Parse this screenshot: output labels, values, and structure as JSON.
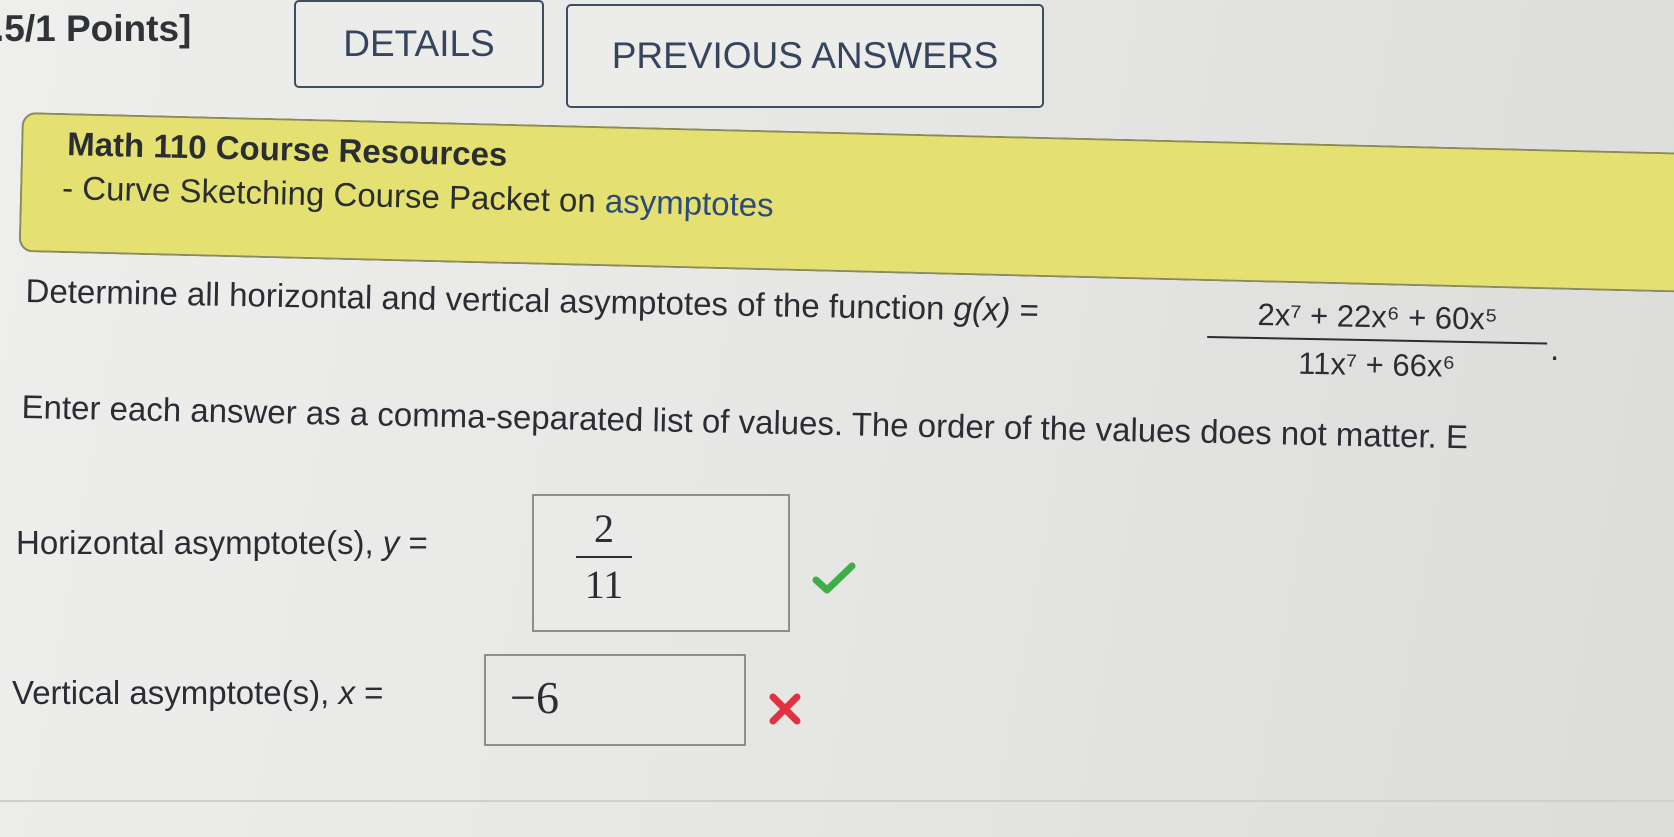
{
  "header": {
    "points": ".5/1 Points]",
    "details_label": "DETAILS",
    "previous_answers_label": "PREVIOUS ANSWERS"
  },
  "resources": {
    "title": "Math 110 Course Resources",
    "link_prefix": "- Curve Sketching Course Packet on ",
    "link_text": "asymptotes",
    "background_color": "#e4e072"
  },
  "question": {
    "text": "Determine all horizontal and vertical asymptotes of the function ",
    "function_name": "g(x)",
    "equals": " =",
    "numerator": "2x⁷ + 22x⁶ + 60x⁵",
    "denominator": "11x⁷ + 66x⁶",
    "period": ".",
    "instructions": "Enter each answer as a comma-separated list of values. The order of the values does not matter. E"
  },
  "answers": {
    "horizontal": {
      "label_prefix": "Horizontal asymptote(s), ",
      "label_var": "y",
      "label_suffix": " =",
      "value_numerator": "2",
      "value_denominator": "11",
      "status": "correct",
      "status_icon": "check-icon",
      "status_color": "#3fae49"
    },
    "vertical": {
      "label_prefix": "Vertical asymptote(s), ",
      "label_var": "x",
      "label_suffix": " =",
      "value": "−6",
      "status": "incorrect",
      "status_icon": "cross-icon",
      "status_color": "#e03342"
    }
  }
}
